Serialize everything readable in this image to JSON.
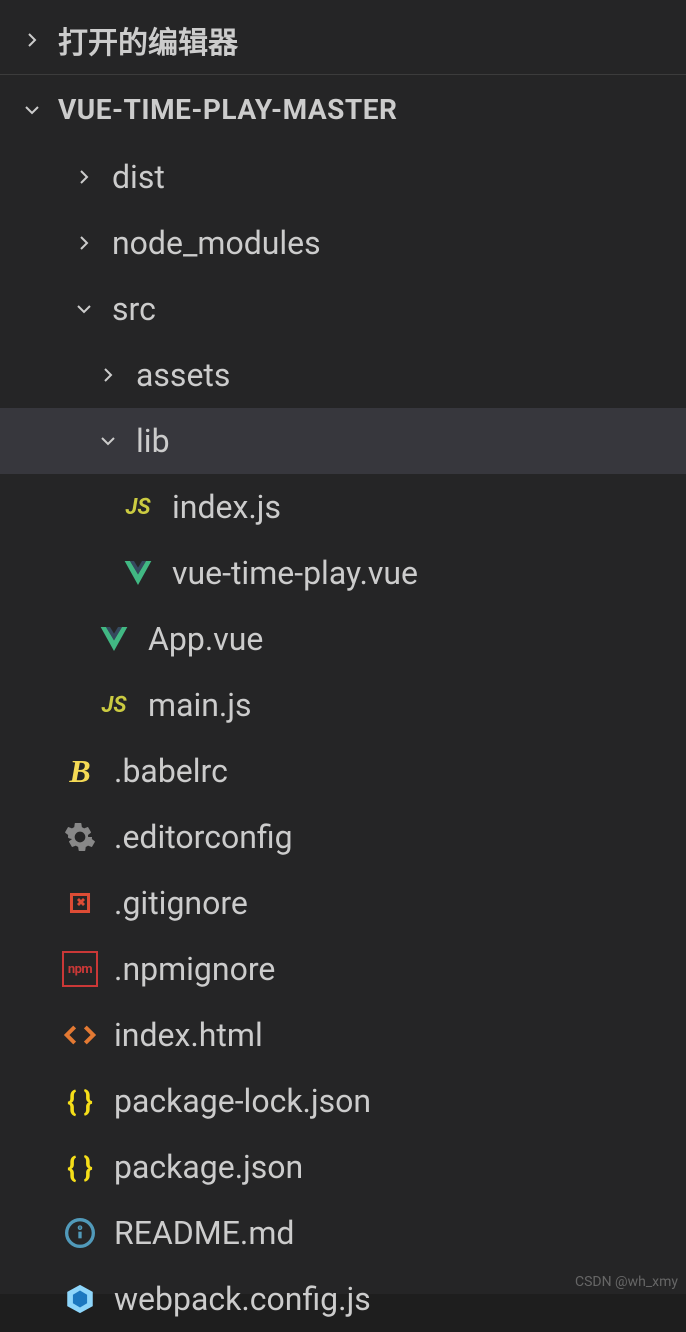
{
  "sections": {
    "open_editors": "打开的编辑器",
    "root": "VUE-TIME-PLAY-MASTER"
  },
  "tree": {
    "dist": "dist",
    "node_modules": "node_modules",
    "src": "src",
    "assets": "assets",
    "lib": "lib",
    "index_js": "index.js",
    "vue_time_play": "vue-time-play.vue",
    "app_vue": "App.vue",
    "main_js": "main.js",
    "babelrc": ".babelrc",
    "editorconfig": ".editorconfig",
    "gitignore": ".gitignore",
    "npmignore": ".npmignore",
    "index_html": "index.html",
    "package_lock": "package-lock.json",
    "package_json": "package.json",
    "readme": "README.md",
    "webpack_config": "webpack.config.js"
  },
  "icons": {
    "js": "JS",
    "npm": "npm",
    "json": "{ }",
    "babel": "B"
  },
  "watermark": "CSDN @wh_xmy"
}
